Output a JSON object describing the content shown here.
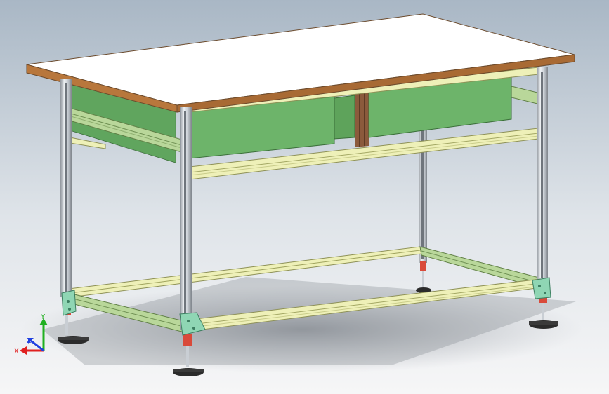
{
  "viewport": {
    "model": "workbench-assembly",
    "background_top": "#a8b6c4",
    "background_bottom": "#f4f5f6"
  },
  "colors": {
    "tabletop_surface": "#ffffff",
    "tabletop_edge": "#a86a34",
    "drawer": "#6db46a",
    "drawer_dark": "#4f8f4c",
    "rail": "#eef0b8",
    "rail_dark": "#bfc27a",
    "profile_green": "#b9d79a",
    "leg": "#d8dde2",
    "leg_dark": "#8a9096",
    "corner_bracket": "#8fd6b4",
    "foot_red": "#d94a3a",
    "foot_pad": "#2b2b2b",
    "divider": "#8b5a3c"
  },
  "triad": {
    "x_label": "X",
    "y_label": "Y",
    "z_label": "Z",
    "x_color": "#e02020",
    "y_color": "#20b020",
    "z_color": "#2040e0"
  }
}
